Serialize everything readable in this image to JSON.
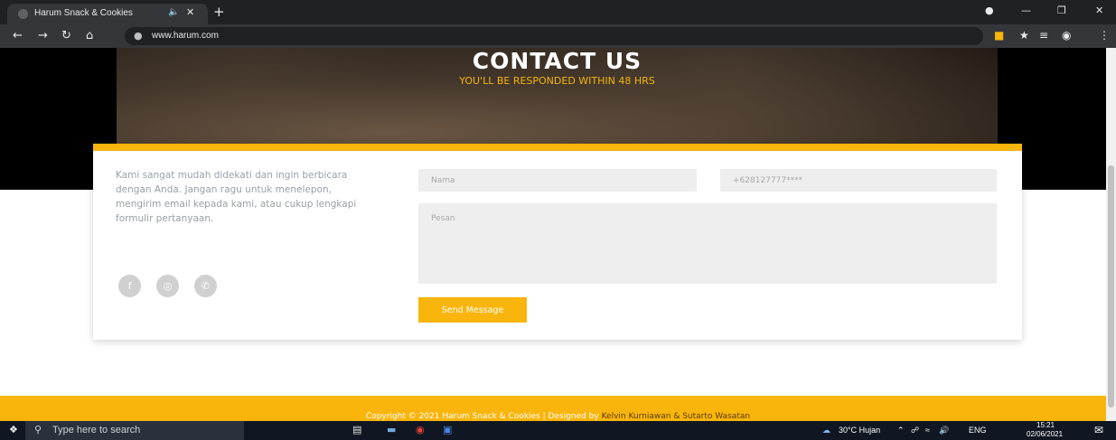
{
  "browser": {
    "tab_title": "Harum Snack & Cookies",
    "url": "www.harum.com"
  },
  "hero": {
    "title": "CONTACT US",
    "subtitle": "YOU'LL BE RESPONDED WITHIN 48 HRS"
  },
  "contact": {
    "intro": "Kami sangat mudah didekati dan ingin berbicara dengan Anda. Jangan ragu untuk menelepon, mengirim email kepada kami, atau cukup lengkapi formulir pertanyaan.",
    "name_placeholder": "Nama",
    "phone_placeholder": "+628127777****",
    "message_placeholder": "Pesan",
    "send_label": "Send Message"
  },
  "footer": {
    "copyright_prefix": "Copyright © 2021 Harum Snack & Cookies | Designed by ",
    "authors": "Kelvin Kurniawan & Sutarto Wasatan"
  },
  "taskbar": {
    "search_placeholder": "Type here to search",
    "weather": "30°C  Hujan",
    "language": "ENG",
    "time": "15:21",
    "date": "02/06/2021"
  },
  "colors": {
    "accent": "#f9b50c",
    "author_link": "#5a3b00"
  }
}
